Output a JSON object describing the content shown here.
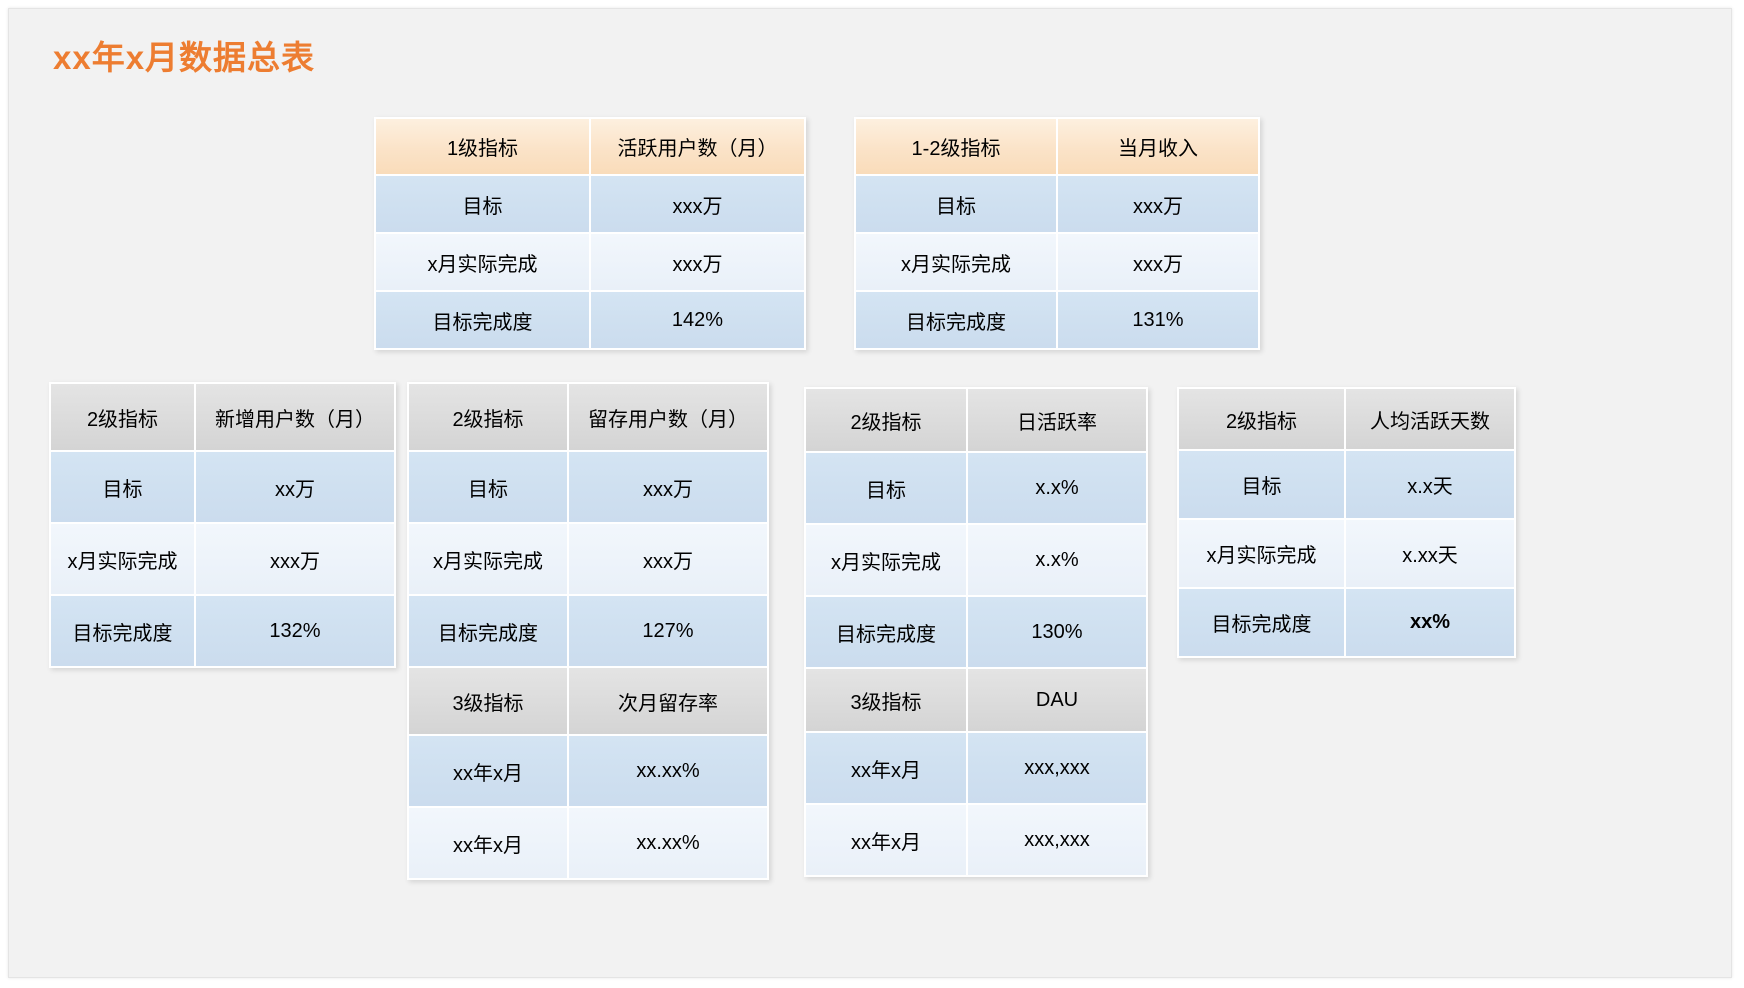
{
  "page": {
    "title": "xx年x月数据总表",
    "title_color": "#ed7d31",
    "background": "#f2f2f2"
  },
  "colors": {
    "header_orange": "#fbe3c8",
    "header_gray": "#dcdcdc",
    "row_blue": "#cfe0f0",
    "row_pale": "#edf3fa",
    "value_red": "#e8192c",
    "value_green": "#13a538"
  },
  "tables": [
    {
      "id": "active-users",
      "header": {
        "label": "1级指标",
        "metric": "活跃用户数（月）",
        "style": "orange"
      },
      "rows": [
        {
          "label": "目标",
          "value": "xxx万",
          "style": "blue",
          "value_style": "normal"
        },
        {
          "label": "x月实际完成",
          "value": "xxx万",
          "style": "pale",
          "value_style": "red"
        },
        {
          "label": "目标完成度",
          "value": "142%",
          "style": "blue",
          "value_style": "percent"
        }
      ]
    },
    {
      "id": "monthly-revenue",
      "header": {
        "label": "1-2级指标",
        "metric": "当月收入",
        "style": "orange"
      },
      "rows": [
        {
          "label": "目标",
          "value": "xxx万",
          "style": "blue",
          "value_style": "normal"
        },
        {
          "label": "x月实际完成",
          "value": "xxx万",
          "style": "pale",
          "value_style": "red"
        },
        {
          "label": "目标完成度",
          "value": "131%",
          "style": "blue",
          "value_style": "percent"
        }
      ]
    },
    {
      "id": "new-users",
      "header": {
        "label": "2级指标",
        "metric": "新增用户数（月）",
        "style": "gray"
      },
      "rows": [
        {
          "label": "目标",
          "value": "xx万",
          "style": "blue",
          "value_style": "normal"
        },
        {
          "label": "x月实际完成",
          "value": "xxx万",
          "style": "pale",
          "value_style": "red"
        },
        {
          "label": "目标完成度",
          "value": "132%",
          "style": "blue",
          "value_style": "percent"
        }
      ]
    },
    {
      "id": "retained-users",
      "header": {
        "label": "2级指标",
        "metric": "留存用户数（月）",
        "style": "gray"
      },
      "rows": [
        {
          "label": "目标",
          "value": "xxx万",
          "style": "blue",
          "value_style": "normal"
        },
        {
          "label": "x月实际完成",
          "value": "xxx万",
          "style": "pale",
          "value_style": "red"
        },
        {
          "label": "目标完成度",
          "value": "127%",
          "style": "blue",
          "value_style": "percent"
        }
      ],
      "sub_header": {
        "label": "3级指标",
        "metric": "次月留存率",
        "style": "gray"
      },
      "sub_rows": [
        {
          "label": "xx年x月",
          "value": "xx.xx%",
          "style": "blue",
          "value_style": "normal"
        },
        {
          "label": "xx年x月",
          "value": "xx.xx%",
          "style": "pale",
          "value_style": "normal"
        }
      ]
    },
    {
      "id": "daily-active-rate",
      "header": {
        "label": "2级指标",
        "metric": "日活跃率",
        "style": "gray"
      },
      "rows": [
        {
          "label": "目标",
          "value": "x.x%",
          "style": "blue",
          "value_style": "normal"
        },
        {
          "label": "x月实际完成",
          "value": "x.x%",
          "style": "pale",
          "value_style": "red"
        },
        {
          "label": "目标完成度",
          "value": "130%",
          "style": "blue",
          "value_style": "percent"
        }
      ],
      "sub_header": {
        "label": "3级指标",
        "metric": "DAU",
        "style": "gray"
      },
      "sub_rows": [
        {
          "label": "xx年x月",
          "value": "xxx,xxx",
          "style": "blue",
          "value_style": "normal"
        },
        {
          "label": "xx年x月",
          "value": "xxx,xxx",
          "style": "pale",
          "value_style": "normal"
        }
      ]
    },
    {
      "id": "avg-active-days",
      "header": {
        "label": "2级指标",
        "metric": "人均活跃天数",
        "style": "gray"
      },
      "rows": [
        {
          "label": "目标",
          "value": "x.x天",
          "style": "blue",
          "value_style": "normal"
        },
        {
          "label": "x月实际完成",
          "value": "x.xx天",
          "style": "pale",
          "value_style": "green"
        },
        {
          "label": "目标完成度",
          "value": "xx%",
          "style": "blue",
          "value_style": "bold"
        }
      ]
    }
  ]
}
